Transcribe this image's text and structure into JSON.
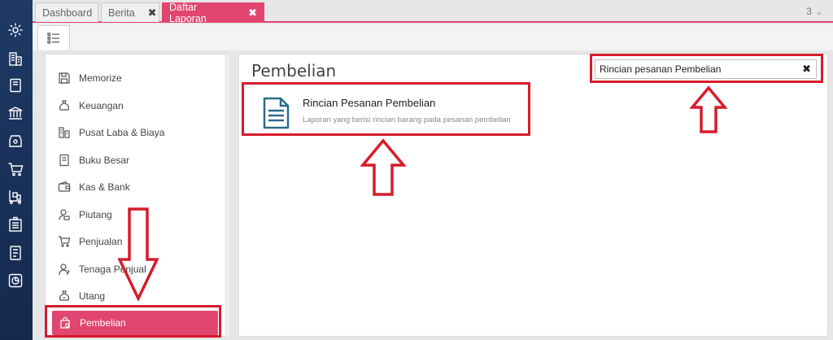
{
  "tabs": [
    {
      "label": "Dashboard",
      "active": false,
      "closable": false
    },
    {
      "label": "Berita",
      "active": false,
      "closable": true
    },
    {
      "label": "Daftar Laporan",
      "active": true,
      "closable": true
    }
  ],
  "tab_count": "3",
  "close_glyph": "✖",
  "rail_icons": [
    "settings-icon",
    "building-icon",
    "book-icon",
    "bank-icon",
    "tag-icon",
    "cart-icon",
    "trolley-icon",
    "warehouse-icon",
    "tax-icon",
    "chart-icon"
  ],
  "menu": [
    {
      "label": "Memorize",
      "icon": "floppy-icon"
    },
    {
      "label": "Keuangan",
      "icon": "money-bag-icon"
    },
    {
      "label": "Pusat Laba & Biaya",
      "icon": "profit-center-icon"
    },
    {
      "label": "Buku Besar",
      "icon": "ledger-icon"
    },
    {
      "label": "Kas & Bank",
      "icon": "wallet-icon"
    },
    {
      "label": "Piutang",
      "icon": "receivable-icon"
    },
    {
      "label": "Penjualan",
      "icon": "cart-icon"
    },
    {
      "label": "Tenaga Penjual",
      "icon": "salesperson-icon"
    },
    {
      "label": "Utang",
      "icon": "payable-icon"
    },
    {
      "label": "Pembelian",
      "icon": "purchase-bag-icon",
      "active": true
    }
  ],
  "panel": {
    "title": "Pembelian",
    "search_value": "Rincian pesanan Pembelian",
    "clear_glyph": "✖"
  },
  "report": {
    "title": "Rincian Pesanan Pembelian",
    "description": "Laporan yang berisi rincian barang pada pesanan pembelian"
  },
  "colors": {
    "accent": "#e0466f",
    "rail": "#1f3a66",
    "annotation": "#d51c2b"
  }
}
